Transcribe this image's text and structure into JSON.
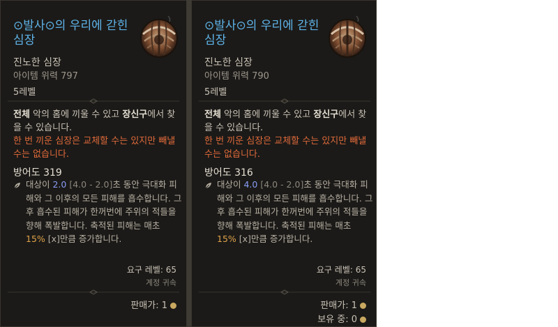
{
  "tooltips": [
    {
      "name": "⊙발사⊙의 우리에 갇힌 심장",
      "name_line1": "⊙발사⊙의 우리에 갇힌",
      "name_line2": "심장",
      "type": "진노한 심장",
      "power": "아이템 위력 797",
      "level": "5레벨",
      "desc_b1": "전체",
      "desc_1": " 악의 홈에 끼울 수 있고 ",
      "desc_b2": "장신구",
      "desc_2": "에서 찾을 수 있습니다.",
      "warning": "한 번 끼운 심장은 교체할 수는 있지만 빼낼 수는 없습니다.",
      "armor": "방어도 319",
      "affix_1": "대상이 ",
      "affix_val": "2.0",
      "affix_range": " [4.0 - 2.0]",
      "affix_2": "초 동안 극대화 피해와 그 이후의 모든 피해를 흡수합니다. 그 후 흡수된 피해가 한꺼번에 주위의 적들을 향해 폭발합니다. 축적된 피해는 매초 ",
      "affix_pct": "15%",
      "affix_3": " [x]만큼 증가합니다.",
      "req": "요구 레벨: 65",
      "bound": "계정 귀속",
      "price": "판매가: 1",
      "owned": ""
    },
    {
      "name": "⊙발사⊙의 우리에 갇힌 심장",
      "name_line1": "⊙발사⊙의 우리에 갇힌",
      "name_line2": "심장",
      "type": "진노한 심장",
      "power": "아이템 위력 790",
      "level": "5레벨",
      "desc_b1": "전체",
      "desc_1": " 악의 홈에 끼울 수 있고 ",
      "desc_b2": "장신구",
      "desc_2": "에서 찾을 수 있습니다.",
      "warning": "한 번 끼운 심장은 교체할 수는 있지만 빼낼 수는 없습니다.",
      "armor": "방어도 316",
      "affix_1": "대상이 ",
      "affix_val": "4.0",
      "affix_range": " [4.0 - 2.0]",
      "affix_2": "초 동안 극대화 피해와 그 이후의 모든 피해를 흡수합니다. 그 후 흡수된 피해가 한꺼번에 주위의 적들을 향해 폭발합니다. 축적된 피해는 매초 ",
      "affix_pct": "15%",
      "affix_3": " [x]만큼 증가합니다.",
      "req": "요구 레벨: 65",
      "bound": "계정 귀속",
      "price": "판매가: 1",
      "owned": "보유 중: 0"
    }
  ],
  "colors": {
    "name": "#5fb3e8",
    "warning": "#e06a3a",
    "affix_value": "#8a9cf5",
    "percent": "#e0a24a",
    "background": "#1b1a18"
  },
  "icons": [
    "heart-cage-icon",
    "affix-bullet-icon",
    "gold-coin-icon"
  ]
}
